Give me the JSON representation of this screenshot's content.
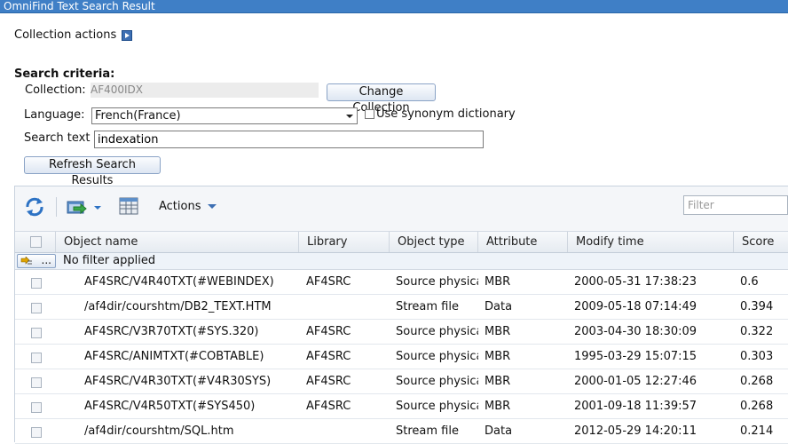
{
  "window": {
    "title": "OmniFind Text Search Result"
  },
  "collection_actions": {
    "label": "Collection actions"
  },
  "criteria": {
    "title": "Search criteria:",
    "collection_label": "Collection:",
    "collection_value": "AF400IDX",
    "change_collection_label": "Change Collection",
    "language_label": "Language:",
    "language_value": "French(France)",
    "synonym_label": "Use synonym dictionary",
    "search_text_label": "Search text",
    "search_text_value": "indexation",
    "refresh_label": "Refresh Search Results"
  },
  "toolbar": {
    "actions_label": "Actions",
    "filter_placeholder": "Filter",
    "icons": [
      "refresh-icon",
      "export-icon",
      "table-settings-icon"
    ]
  },
  "table": {
    "columns": [
      "Object name",
      "Library",
      "Object type",
      "Attribute",
      "Modify time",
      "Score"
    ],
    "filter_button": "...",
    "filter_text": "No filter applied",
    "rows": [
      {
        "name": "AF4SRC/V4R40TXT(#WEBINDEX)",
        "library": "AF4SRC",
        "type": "Source physica",
        "attribute": "MBR",
        "modified": "2000-05-31 17:38:23",
        "score": "0.6"
      },
      {
        "name": "/af4dir/courshtm/DB2_TEXT.HTM",
        "library": "",
        "type": "Stream file",
        "attribute": "Data",
        "modified": "2009-05-18 07:14:49",
        "score": "0.394"
      },
      {
        "name": "AF4SRC/V3R70TXT(#SYS.320)",
        "library": "AF4SRC",
        "type": "Source physica",
        "attribute": "MBR",
        "modified": "2003-04-30 18:30:09",
        "score": "0.322"
      },
      {
        "name": "AF4SRC/ANIMTXT(#COBTABLE)",
        "library": "AF4SRC",
        "type": "Source physica",
        "attribute": "MBR",
        "modified": "1995-03-29 15:07:15",
        "score": "0.303"
      },
      {
        "name": "AF4SRC/V4R30TXT(#V4R30SYS)",
        "library": "AF4SRC",
        "type": "Source physica",
        "attribute": "MBR",
        "modified": "2000-01-05 12:27:46",
        "score": "0.268"
      },
      {
        "name": "AF4SRC/V4R50TXT(#SYS450)",
        "library": "AF4SRC",
        "type": "Source physica",
        "attribute": "MBR",
        "modified": "2001-09-18 11:39:57",
        "score": "0.268"
      },
      {
        "name": "/af4dir/courshtm/SQL.htm",
        "library": "",
        "type": "Stream file",
        "attribute": "Data",
        "modified": "2012-05-29 14:20:11",
        "score": "0.214"
      }
    ]
  },
  "colors": {
    "title_bar": "#3f7fc6",
    "accent": "#3d6fb3"
  }
}
